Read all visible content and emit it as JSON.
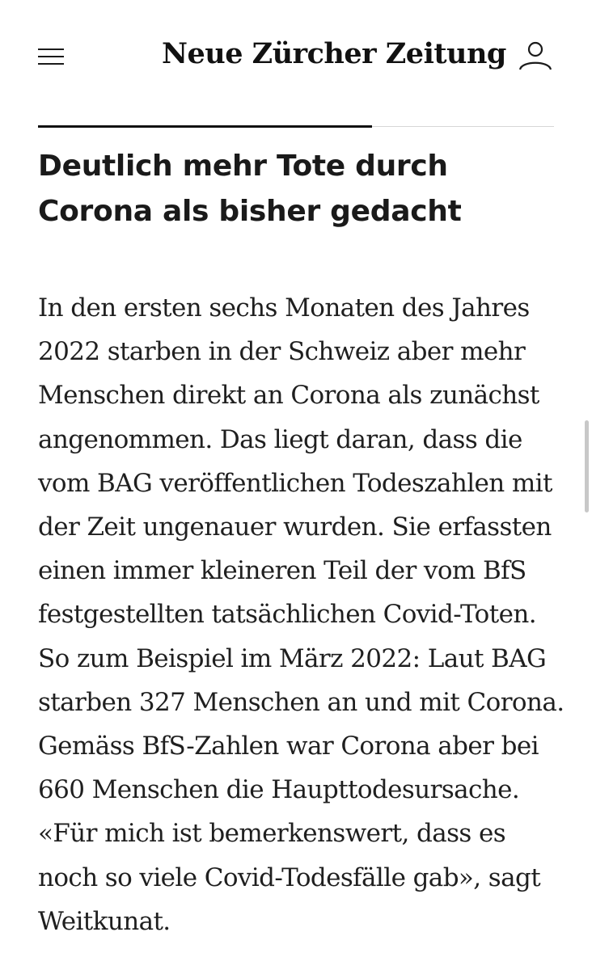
{
  "header": {
    "logo_text": "Neue Zürcher Zeitung",
    "menu_icon": "hamburger-menu-icon",
    "user_icon": "user-account-icon"
  },
  "article": {
    "headline": "Deutlich mehr Tote durch Corona als bisher gedacht",
    "body": "In den ersten sechs Monaten des Jahres 2022 starben in der Schweiz aber mehr Menschen direkt an Corona als zunächst angenommen. Das liegt daran, dass die vom BAG veröffentlichen Todeszahlen mit der Zeit ungenauer wurden. Sie erfassten einen immer kleineren Teil der vom BfS festgestellten tatsächlichen Covid-Toten. So zum Beispiel im März 2022: Laut BAG starben 327 Menschen an und mit Corona. Gemäss BfS-Zahlen war Corona aber bei 660 Menschen die Haupttodesursache. «Für mich ist bemerkenswert, dass es noch so viele Covid-Todesfälle gab», sagt Weitkunat."
  },
  "colors": {
    "text": "#1a1a1a",
    "rule_light": "#d6d6d6",
    "background": "#ffffff"
  }
}
